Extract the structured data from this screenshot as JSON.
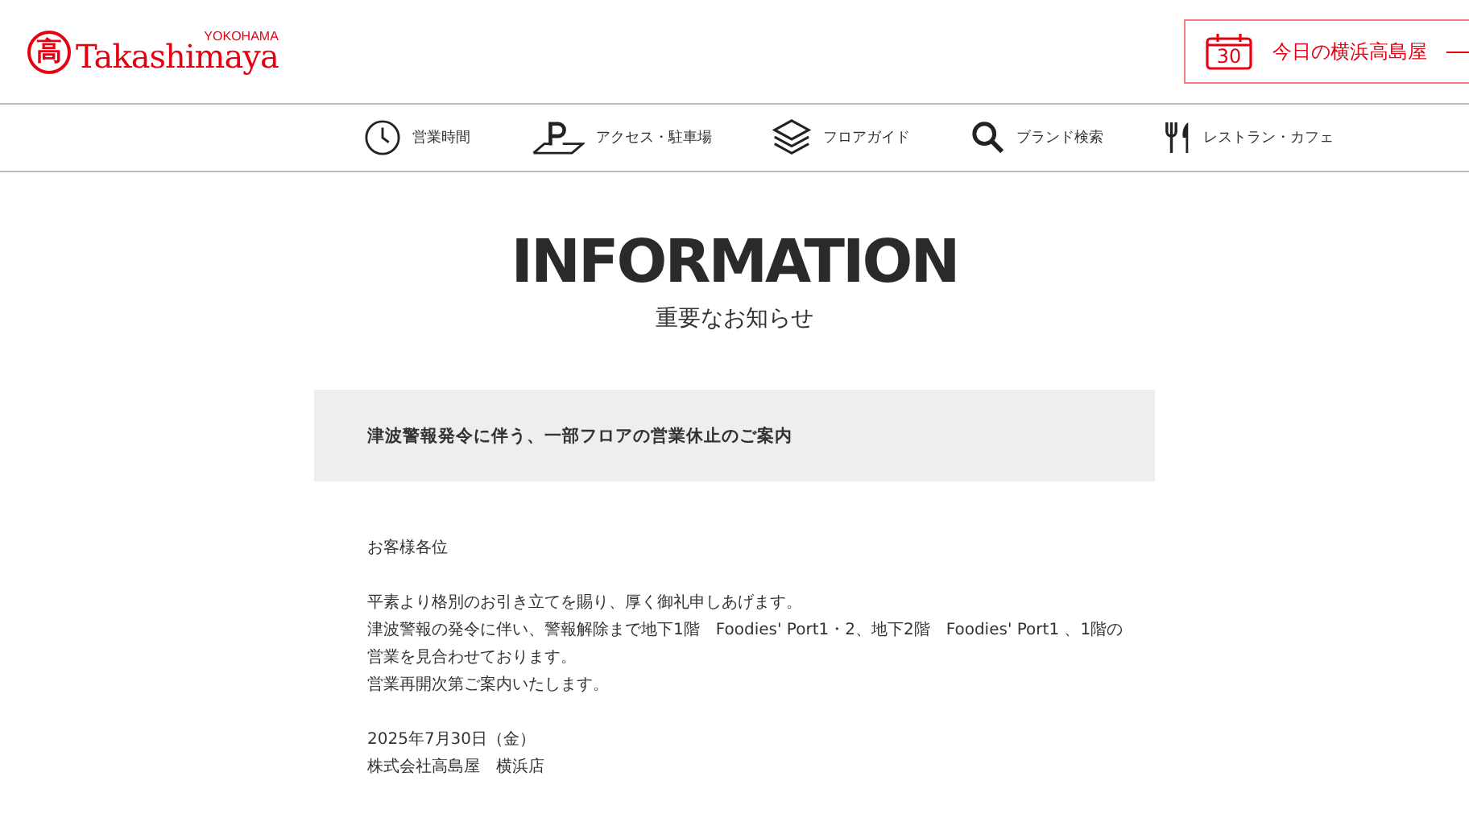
{
  "header": {
    "logo": {
      "mark": "高",
      "name": "Takashimaya",
      "branch": "YOKOHAMA"
    },
    "today": {
      "day": "30",
      "label": "今日の横浜高島屋"
    }
  },
  "nav": [
    {
      "kind": "clock",
      "label": "営業時間"
    },
    {
      "kind": "parking",
      "label": "アクセス・駐車場"
    },
    {
      "kind": "layers",
      "label": "フロアガイド"
    },
    {
      "kind": "search",
      "label": "ブランド検索"
    },
    {
      "kind": "cutlery",
      "label": "レストラン・カフェ"
    }
  ],
  "page": {
    "title": "INFORMATION",
    "subtitle": "重要なお知らせ"
  },
  "notice": {
    "heading": "津波警報発令に伴う、一部フロアの営業休止のご案内",
    "paragraphs": [
      [
        "お客様各位"
      ],
      [
        "平素より格別のお引き立てを賜り、厚く御礼申しあげます。",
        "津波警報の発令に伴い、警報解除まで地下1階　Foodies' Port1・2、地下2階　Foodies' Port1 、1階の",
        "営業を見合わせております。",
        "営業再開次第ご案内いたします。"
      ],
      [
        "2025年7月30日（金）",
        "株式会社高島屋　横浜店"
      ]
    ]
  }
}
